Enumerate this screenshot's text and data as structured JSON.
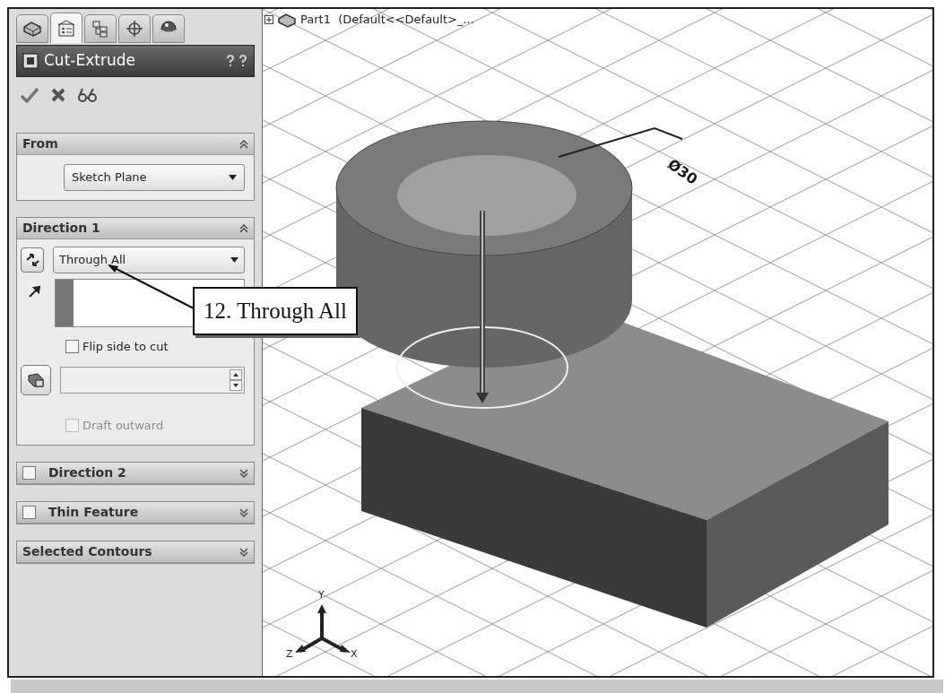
{
  "tabs": [
    {
      "kind": "part",
      "selected": false
    },
    {
      "kind": "property",
      "selected": true
    },
    {
      "kind": "config",
      "selected": false
    },
    {
      "kind": "crosshair",
      "selected": false
    },
    {
      "kind": "appearance",
      "selected": false
    }
  ],
  "panel": {
    "title": "Cut-Extrude"
  },
  "sections": [
    {
      "kind": "from",
      "title": "From",
      "expanded": true,
      "dropdown": "Sketch Plane"
    },
    {
      "kind": "direction",
      "title": "Direction 1",
      "expanded": true,
      "end_condition": "Through All",
      "flip": {
        "label": "Flip side to cut",
        "checked": false
      },
      "draft": {
        "label": "Draft outward",
        "checked": false,
        "disabled": true
      }
    },
    {
      "kind": "optional",
      "title": "Direction 2",
      "expanded": false,
      "checked": false
    },
    {
      "kind": "optional",
      "title": "Thin Feature",
      "expanded": false,
      "checked": false
    },
    {
      "kind": "plain",
      "title": "Selected Contours",
      "expanded": false
    }
  ],
  "viewport": {
    "tree_label": "Part1  (Default<<Default>_...",
    "dimension": "Ø30",
    "axes": {
      "x": "X",
      "y": "Y",
      "z": "Z"
    }
  },
  "callout": "12. Through All"
}
